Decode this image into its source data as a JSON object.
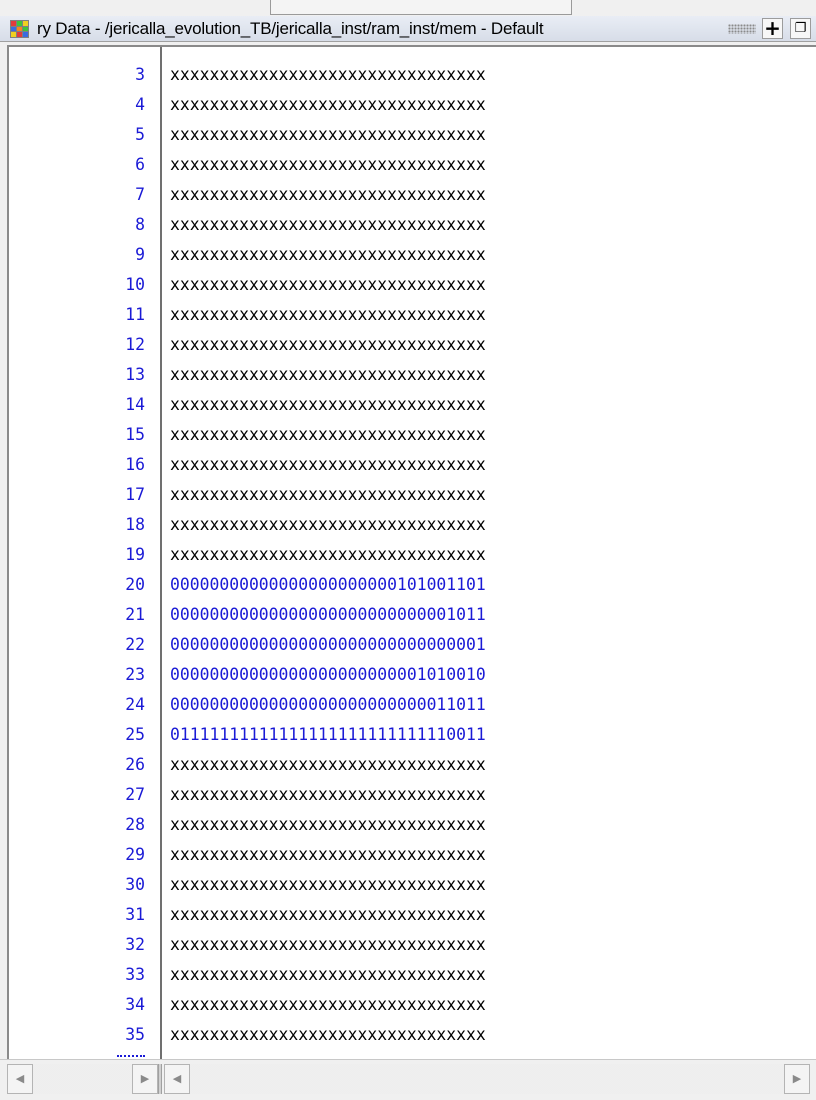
{
  "window": {
    "title": "ry Data - /jericalla_evolution_TB/jericalla_inst/ram_inst/mem - Default",
    "app_icon": "memory-grid-icon",
    "buttons": [
      {
        "name": "add",
        "glyph": "+",
        "icon": "plus-icon"
      },
      {
        "name": "undock",
        "glyph": "❐",
        "icon": "undock-icon"
      }
    ]
  },
  "colors": {
    "address": "#1a1ad6",
    "bits": "#1a1ad6",
    "unknown": "#000000",
    "divider": "#707070"
  },
  "memory": {
    "rows": [
      {
        "addr": "3",
        "value": "xxxxxxxxxxxxxxxxxxxxxxxxxxxxxxxx"
      },
      {
        "addr": "4",
        "value": "xxxxxxxxxxxxxxxxxxxxxxxxxxxxxxxx"
      },
      {
        "addr": "5",
        "value": "xxxxxxxxxxxxxxxxxxxxxxxxxxxxxxxx"
      },
      {
        "addr": "6",
        "value": "xxxxxxxxxxxxxxxxxxxxxxxxxxxxxxxx"
      },
      {
        "addr": "7",
        "value": "xxxxxxxxxxxxxxxxxxxxxxxxxxxxxxxx"
      },
      {
        "addr": "8",
        "value": "xxxxxxxxxxxxxxxxxxxxxxxxxxxxxxxx"
      },
      {
        "addr": "9",
        "value": "xxxxxxxxxxxxxxxxxxxxxxxxxxxxxxxx"
      },
      {
        "addr": "10",
        "value": "xxxxxxxxxxxxxxxxxxxxxxxxxxxxxxxx"
      },
      {
        "addr": "11",
        "value": "xxxxxxxxxxxxxxxxxxxxxxxxxxxxxxxx"
      },
      {
        "addr": "12",
        "value": "xxxxxxxxxxxxxxxxxxxxxxxxxxxxxxxx"
      },
      {
        "addr": "13",
        "value": "xxxxxxxxxxxxxxxxxxxxxxxxxxxxxxxx"
      },
      {
        "addr": "14",
        "value": "xxxxxxxxxxxxxxxxxxxxxxxxxxxxxxxx"
      },
      {
        "addr": "15",
        "value": "xxxxxxxxxxxxxxxxxxxxxxxxxxxxxxxx"
      },
      {
        "addr": "16",
        "value": "xxxxxxxxxxxxxxxxxxxxxxxxxxxxxxxx"
      },
      {
        "addr": "17",
        "value": "xxxxxxxxxxxxxxxxxxxxxxxxxxxxxxxx"
      },
      {
        "addr": "18",
        "value": "xxxxxxxxxxxxxxxxxxxxxxxxxxxxxxxx"
      },
      {
        "addr": "19",
        "value": "xxxxxxxxxxxxxxxxxxxxxxxxxxxxxxxx"
      },
      {
        "addr": "20",
        "value": "00000000000000000000000101001101"
      },
      {
        "addr": "21",
        "value": "00000000000000000000000000001011"
      },
      {
        "addr": "22",
        "value": "00000000000000000000000000000001"
      },
      {
        "addr": "23",
        "value": "00000000000000000000000001010010"
      },
      {
        "addr": "24",
        "value": "00000000000000000000000000011011"
      },
      {
        "addr": "25",
        "value": "01111111111111111111111111110011"
      },
      {
        "addr": "26",
        "value": "xxxxxxxxxxxxxxxxxxxxxxxxxxxxxxxx"
      },
      {
        "addr": "27",
        "value": "xxxxxxxxxxxxxxxxxxxxxxxxxxxxxxxx"
      },
      {
        "addr": "28",
        "value": "xxxxxxxxxxxxxxxxxxxxxxxxxxxxxxxx"
      },
      {
        "addr": "29",
        "value": "xxxxxxxxxxxxxxxxxxxxxxxxxxxxxxxx"
      },
      {
        "addr": "30",
        "value": "xxxxxxxxxxxxxxxxxxxxxxxxxxxxxxxx"
      },
      {
        "addr": "31",
        "value": "xxxxxxxxxxxxxxxxxxxxxxxxxxxxxxxx"
      },
      {
        "addr": "32",
        "value": "xxxxxxxxxxxxxxxxxxxxxxxxxxxxxxxx"
      },
      {
        "addr": "33",
        "value": "xxxxxxxxxxxxxxxxxxxxxxxxxxxxxxxx"
      },
      {
        "addr": "34",
        "value": "xxxxxxxxxxxxxxxxxxxxxxxxxxxxxxxx"
      },
      {
        "addr": "35",
        "value": "xxxxxxxxxxxxxxxxxxxxxxxxxxxxxxxx"
      }
    ]
  },
  "scrollbars": {
    "left_arrow": "◀",
    "right_arrow": "▶"
  }
}
